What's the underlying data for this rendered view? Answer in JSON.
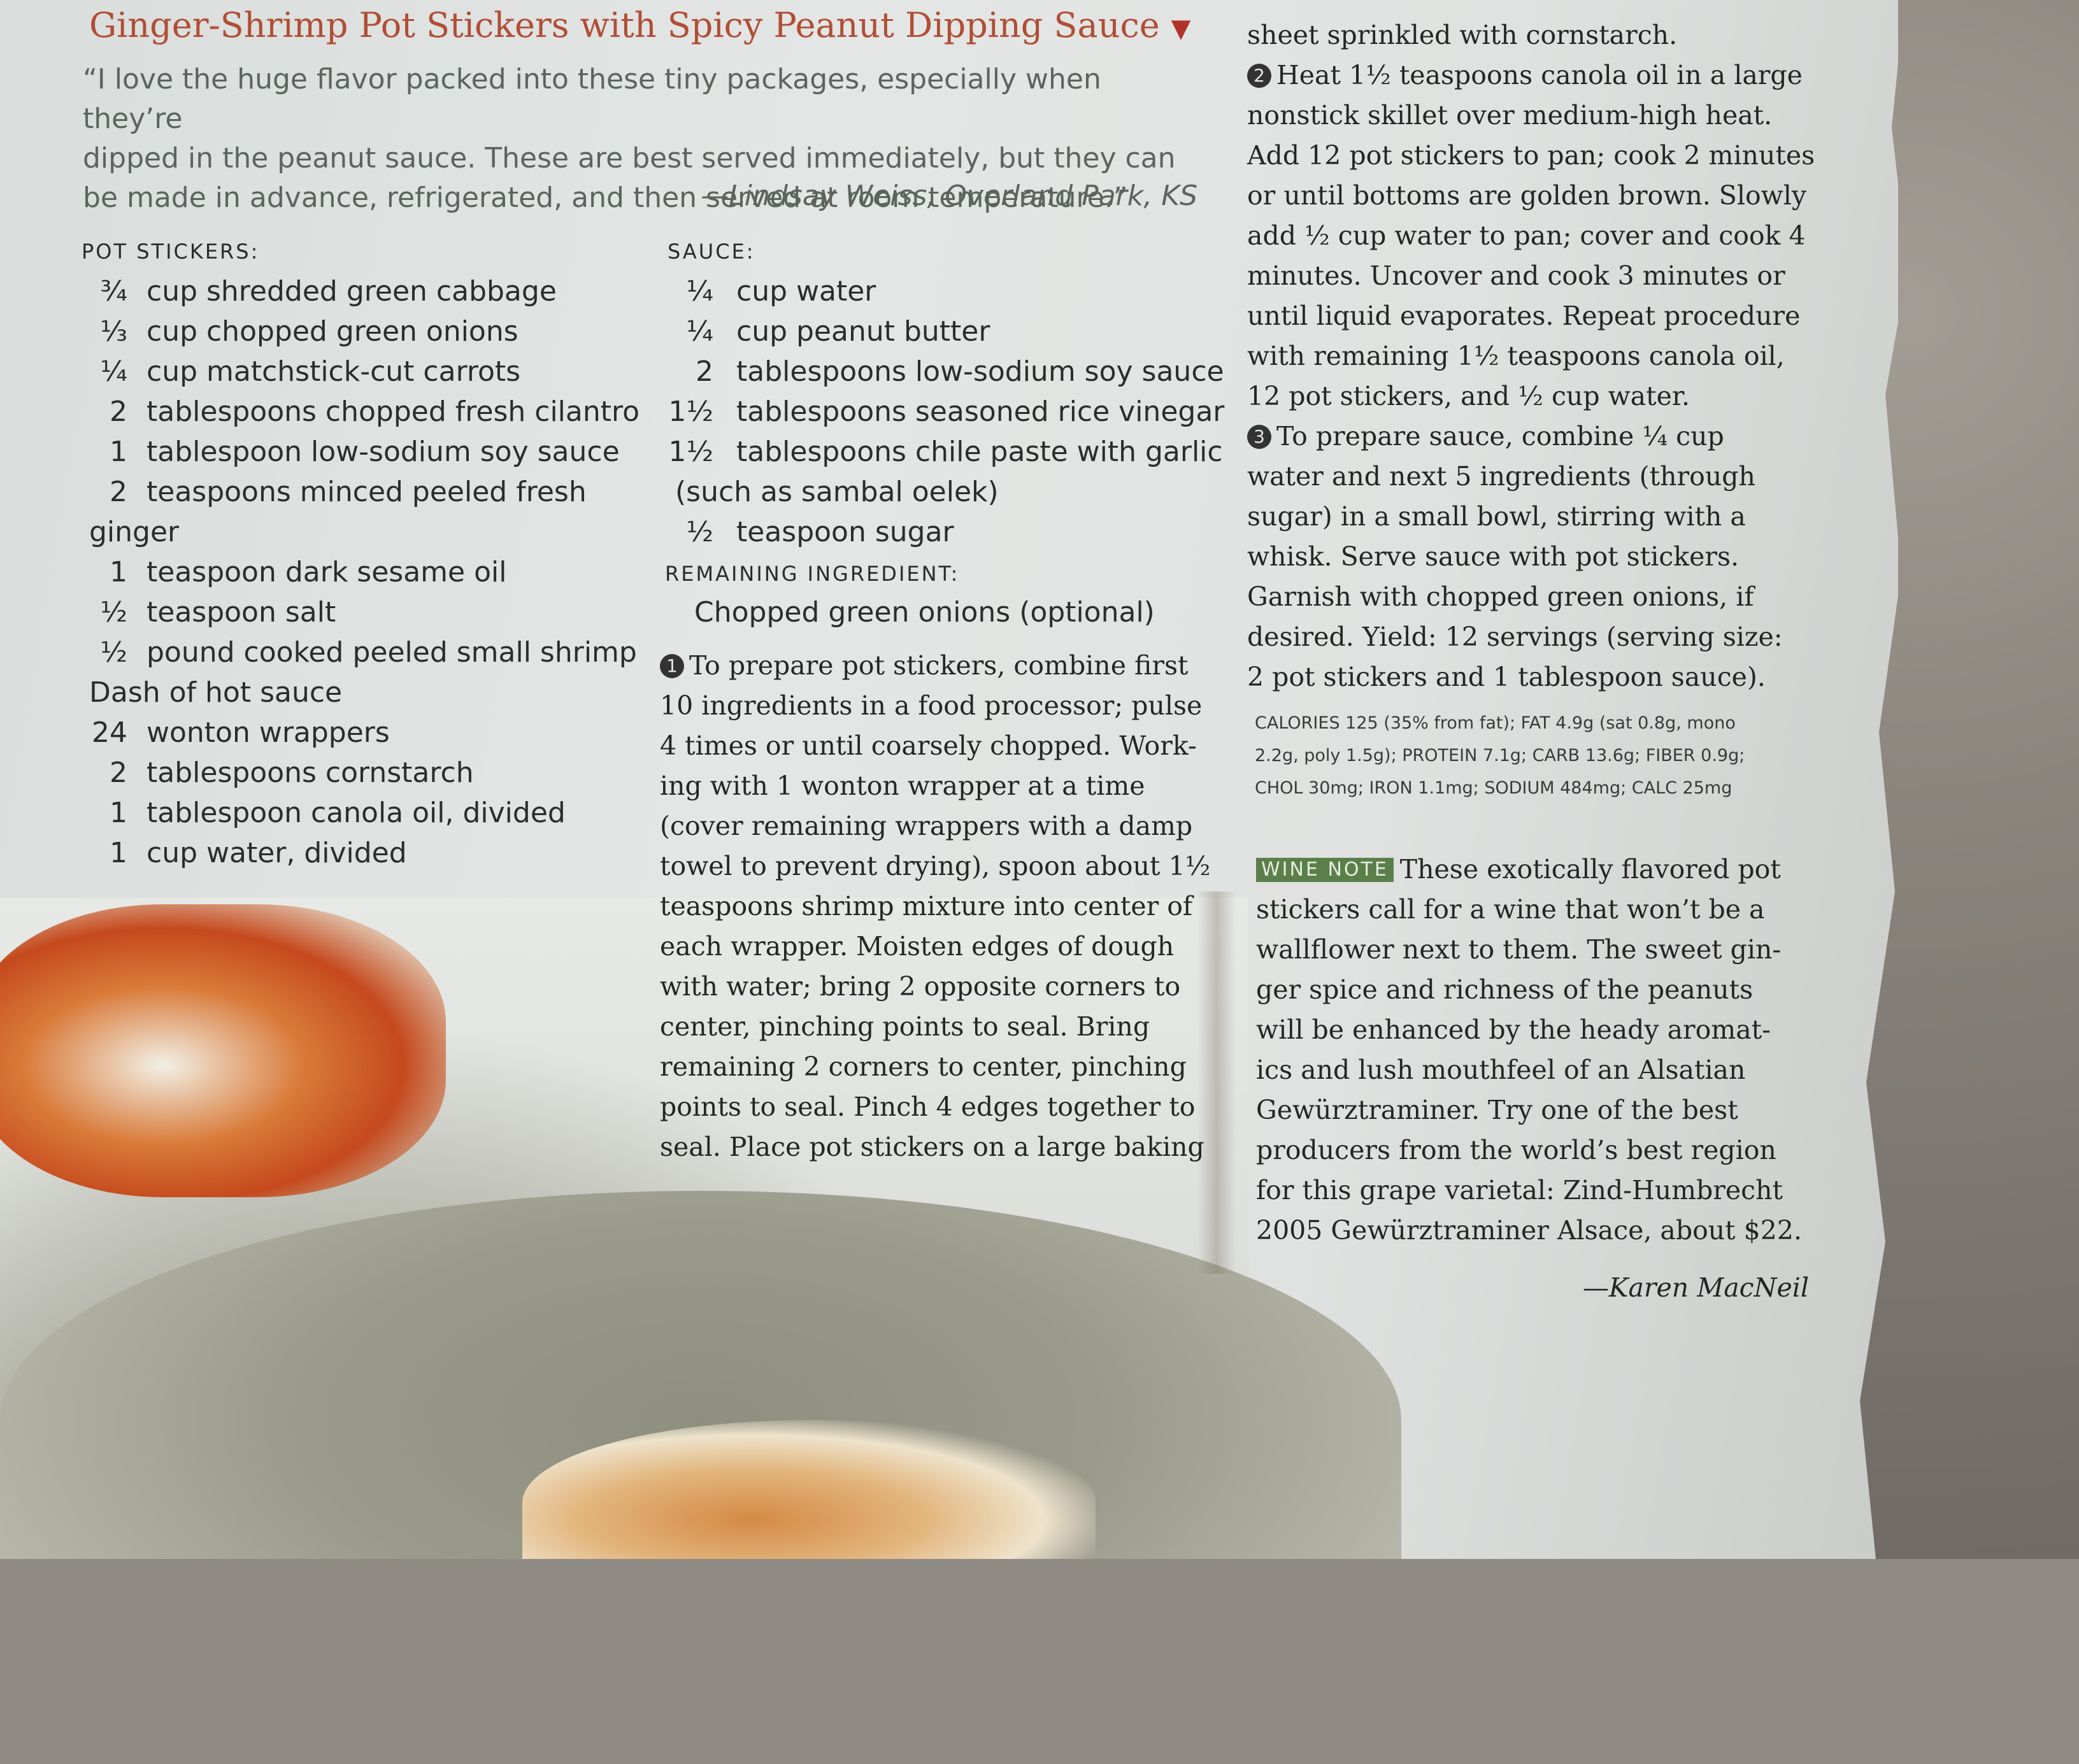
{
  "title": "Ginger-Shrimp Pot Stickers with Spicy Peanut Dipping Sauce",
  "title_marker": "▼",
  "quote_lines": [
    "“I love the huge flavor packed into these tiny packages, especially when they’re",
    "dipped in the peanut sauce. These are best served immediately, but they can",
    "be made in advance, refrigerated, and then served at room temperature.”"
  ],
  "attribution": "—Lindsay Weiss, Overland Park, KS",
  "pot_stickers": {
    "heading": "POT STICKERS:",
    "items": [
      {
        "amount": "¾",
        "text": "cup shredded green cabbage"
      },
      {
        "amount": "⅓",
        "text": "cup chopped green onions"
      },
      {
        "amount": "¼",
        "text": "cup matchstick-cut carrots"
      },
      {
        "amount": "2",
        "text": "tablespoons chopped fresh cilantro"
      },
      {
        "amount": "1",
        "text": "tablespoon low-sodium soy sauce"
      },
      {
        "amount": "2",
        "text": "teaspoons minced peeled fresh"
      },
      {
        "amount": "",
        "text": "ginger"
      },
      {
        "amount": "1",
        "text": "teaspoon dark sesame oil"
      },
      {
        "amount": "½",
        "text": "teaspoon salt"
      },
      {
        "amount": "½",
        "text": "pound cooked peeled small shrimp"
      },
      {
        "amount": "",
        "text": "Dash of hot sauce"
      },
      {
        "amount": "24",
        "text": "wonton wrappers"
      },
      {
        "amount": "2",
        "text": "tablespoons cornstarch"
      },
      {
        "amount": "1",
        "text": "tablespoon canola oil, divided"
      },
      {
        "amount": "1",
        "text": "cup water, divided"
      }
    ]
  },
  "sauce": {
    "heading": "SAUCE:",
    "items": [
      {
        "amount": "¼",
        "text": "cup water"
      },
      {
        "amount": "¼",
        "text": "cup peanut butter"
      },
      {
        "amount": "2",
        "text": "tablespoons low-sodium soy sauce"
      },
      {
        "amount": "1½",
        "text": "tablespoons seasoned rice vinegar"
      },
      {
        "amount": "1½",
        "text": "tablespoons chile paste with garlic"
      },
      {
        "amount": "",
        "text": "(such as sambal oelek)"
      },
      {
        "amount": "½",
        "text": "teaspoon sugar"
      }
    ]
  },
  "remaining": {
    "heading": "REMAINING INGREDIENT:",
    "text": "Chopped green onions (optional)"
  },
  "step1": {
    "number": "1",
    "lines": [
      "To prepare pot stickers, combine first",
      "10 ingredients in a food processor; pulse",
      "4 times or until coarsely chopped. Work-",
      "ing with 1 wonton wrapper at a time",
      "(cover remaining wrappers with a damp",
      "towel to prevent drying), spoon about 1½",
      "teaspoons shrimp mixture into center of",
      "each wrapper. Moisten edges of dough",
      "with water; bring 2 opposite corners to",
      "center, pinching points to seal. Bring",
      "remaining 2 corners to center, pinching",
      "points to seal. Pinch 4 edges together to",
      "seal. Place pot stickers on a large baking"
    ]
  },
  "column3": {
    "lead": "sheet sprinkled with cornstarch.",
    "step2_number": "2",
    "step2_lines": [
      "Heat 1½ teaspoons canola oil in a large",
      "nonstick skillet over medium-high heat.",
      "Add 12 pot stickers to pan; cook 2 minutes",
      "or until bottoms are golden brown. Slowly",
      "add ½ cup water to pan; cover and cook 4",
      "minutes. Uncover and cook 3 minutes or",
      "until liquid evaporates. Repeat procedure",
      "with remaining 1½ teaspoons canola oil,",
      "12 pot stickers, and ½ cup water."
    ],
    "step3_number": "3",
    "step3_lines": [
      "To prepare sauce, combine ¼ cup",
      "water and next 5 ingredients (through",
      "sugar) in a small bowl, stirring with a",
      "whisk. Serve sauce with pot stickers.",
      "Garnish with chopped green onions, if",
      "desired. Yield: 12 servings (serving size:",
      "2 pot stickers and 1 tablespoon sauce)."
    ]
  },
  "nutrition_lines": [
    "CALORIES 125 (35% from fat); FAT 4.9g (sat 0.8g, mono",
    "2.2g, poly 1.5g); PROTEIN 7.1g; CARB 13.6g; FIBER 0.9g;",
    "CHOL 30mg; IRON 1.1mg; SODIUM 484mg; CALC 25mg"
  ],
  "wine_note": {
    "badge": "WINE NOTE",
    "lines": [
      "These exotically flavored pot",
      "stickers call for a wine that won’t be a",
      "wallflower next to them. The sweet gin-",
      "ger spice and richness of the peanuts",
      "will be enhanced by the heady aromat-",
      "ics and lush mouthfeel of an Alsatian",
      "Gewürztraminer. Try one of the best",
      "producers from the world’s best region",
      "for this grape varietal: Zind-Humbrecht",
      "2005 Gewürztraminer Alsace, about $22."
    ],
    "signature": "—Karen MacNeil"
  },
  "colors": {
    "title": "#b14d35",
    "wine_badge": "#5b7f4a"
  }
}
